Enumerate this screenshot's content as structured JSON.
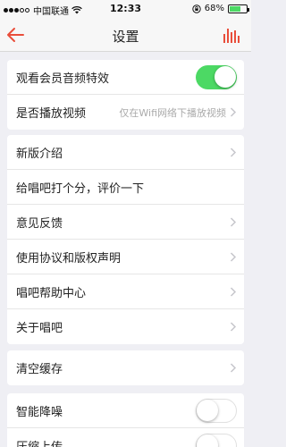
{
  "status_bar": {
    "carrier": "中国联通",
    "time": "12:33",
    "battery": "68%",
    "battery_level": 0.68
  },
  "nav": {
    "title": "设置",
    "back_icon": "back-arrow-icon",
    "right_icon": "audio-bars-icon",
    "accent_color": "#e94e3b"
  },
  "group1": {
    "items": [
      {
        "label": "观看会员音频特效",
        "toggle": "on"
      },
      {
        "label": "是否播放视频",
        "value": "仅在Wifi网络下播放视频"
      }
    ]
  },
  "group2": {
    "items": [
      {
        "label": "新版介绍"
      },
      {
        "label": "给唱吧打个分，评价一下"
      },
      {
        "label": "意见反馈"
      },
      {
        "label": "使用协议和版权声明"
      },
      {
        "label": "唱吧帮助中心"
      },
      {
        "label": "关于唱吧"
      }
    ]
  },
  "group3": {
    "items": [
      {
        "label": "清空缓存"
      }
    ]
  },
  "group4": {
    "items": [
      {
        "label": "智能降噪",
        "toggle": "off"
      },
      {
        "label": "压缩上传"
      }
    ]
  }
}
